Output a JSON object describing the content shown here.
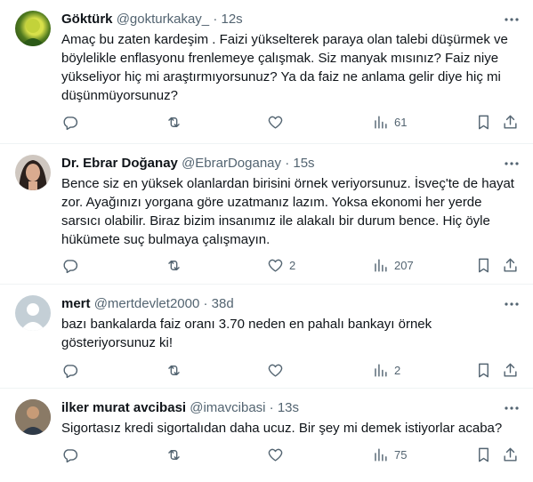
{
  "tweets": [
    {
      "name": "Göktürk",
      "handle": "@gokturkakay_",
      "dot": "·",
      "time": "12s",
      "text": "Amaç bu zaten kardeşim . Faizi yükselterek paraya olan talebi düşürmek ve böylelikle enflasyonu frenlemeye çalışmak. Siz manyak mısınız? Faiz niye yükseliyor hiç mi araştırmıyorsunuz? Ya da faiz ne anlama gelir diye hiç mi düşünmüyorsunuz?",
      "likes": "",
      "views": "61"
    },
    {
      "name": "Dr. Ebrar Doğanay",
      "handle": "@EbrarDoganay",
      "dot": "·",
      "time": "15s",
      "text": "Bence siz en yüksek olanlardan birisini örnek veriyorsunuz. İsveç'te de hayat zor. Ayağınızı yorgana göre uzatmanız lazım. Yoksa ekonomi her yerde sarsıcı olabilir. Biraz bizim insanımız ile alakalı bir durum bence. Hiç öyle hükümete suç bulmaya çalışmayın.",
      "likes": "2",
      "views": "207"
    },
    {
      "name": "mert",
      "handle": "@mertdevlet2000",
      "dot": "·",
      "time": "38d",
      "text": "bazı bankalarda faiz oranı 3.70 neden en pahalı bankayı örnek gösteriyorsunuz ki!",
      "likes": "",
      "views": "2"
    },
    {
      "name": "ilker murat avcibasi",
      "handle": "@imavcibasi",
      "dot": "·",
      "time": "13s",
      "text": "Sigortasız kredi sigortalıdan daha ucuz. Bir şey mi demek istiyorlar acaba?",
      "likes": "",
      "views": "75"
    }
  ]
}
